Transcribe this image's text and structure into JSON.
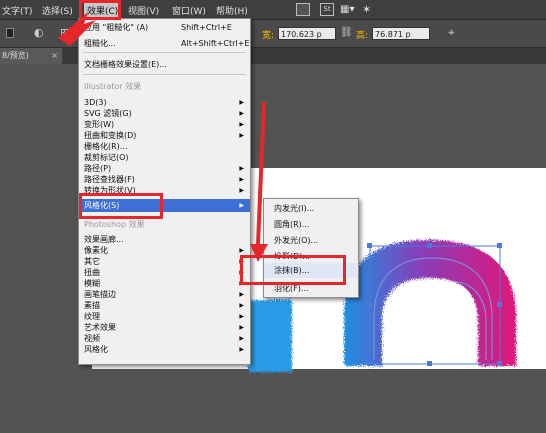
{
  "menubar": {
    "items": [
      "文字(T)",
      "选择(S)",
      "效果(C)",
      "视图(V)",
      "窗口(W)",
      "帮助(H)"
    ],
    "active_item": "效果(C)",
    "icons": [
      "document-icon",
      "layout-icon",
      "spiral-icon"
    ]
  },
  "controlbar": {
    "width_label": "宽:",
    "width_value": "170.623 p",
    "height_label": "高:",
    "height_value": "76.871 p"
  },
  "tab": {
    "label": "8/预览)",
    "close": "×"
  },
  "effect_menu": {
    "apply_last": {
      "label": "应用 \"粗糙化\" (A)",
      "shortcut": "Shift+Ctrl+E"
    },
    "last_effect": {
      "label": "粗糙化...",
      "shortcut": "Alt+Shift+Ctrl+E"
    },
    "raster_settings": "文档栅格效果设置(E)...",
    "illustrator_header": "Illustrator 效果",
    "illustrator_items": [
      "3D(3)",
      "SVG 滤镜(G)",
      "变形(W)",
      "扭曲和变换(D)",
      "栅格化(R)...",
      "裁剪标记(O)",
      "路径(P)",
      "路径查找器(F)",
      "转换为形状(V)",
      "风格化(S)"
    ],
    "photoshop_header": "Photoshop 效果",
    "photoshop_items": [
      "效果画廊...",
      "像素化",
      "其它",
      "扭曲",
      "模糊",
      "画笔描边",
      "素描",
      "纹理",
      "艺术效果",
      "视频",
      "风格化"
    ]
  },
  "stylize_submenu": {
    "items": [
      "内发光(I)...",
      "圆角(R)...",
      "外发光(O)...",
      "投影(D)...",
      "涂抹(B)...",
      "羽化(F)..."
    ]
  },
  "colors": {
    "highlight": "#3d6fd6",
    "annotation_red": "#e5262b",
    "fur_blue": "#1e8fe0",
    "fur_purple": "#8a3db8",
    "fur_magenta": "#e0187a"
  }
}
